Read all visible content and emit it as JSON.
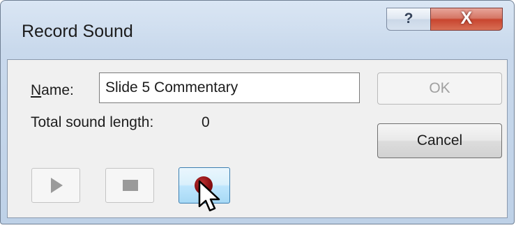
{
  "window": {
    "title": "Record Sound",
    "help_glyph": "?",
    "close_glyph": "X"
  },
  "form": {
    "name_label_mnemonic": "N",
    "name_label_rest": "ame:",
    "name_value": "Slide 5 Commentary",
    "length_label": "Total sound length:",
    "length_value": "0"
  },
  "buttons": {
    "ok_label": "OK",
    "ok_enabled": false,
    "cancel_label": "Cancel"
  },
  "media_controls": [
    {
      "name": "play",
      "icon": "play-icon",
      "enabled": false
    },
    {
      "name": "stop",
      "icon": "stop-icon",
      "enabled": false
    },
    {
      "name": "record",
      "icon": "record-icon",
      "enabled": true,
      "state": "hover"
    }
  ],
  "colors": {
    "record_dot": "#8b0f12",
    "close_button": "#c8452f",
    "title_bar": "#c9d9ec"
  }
}
